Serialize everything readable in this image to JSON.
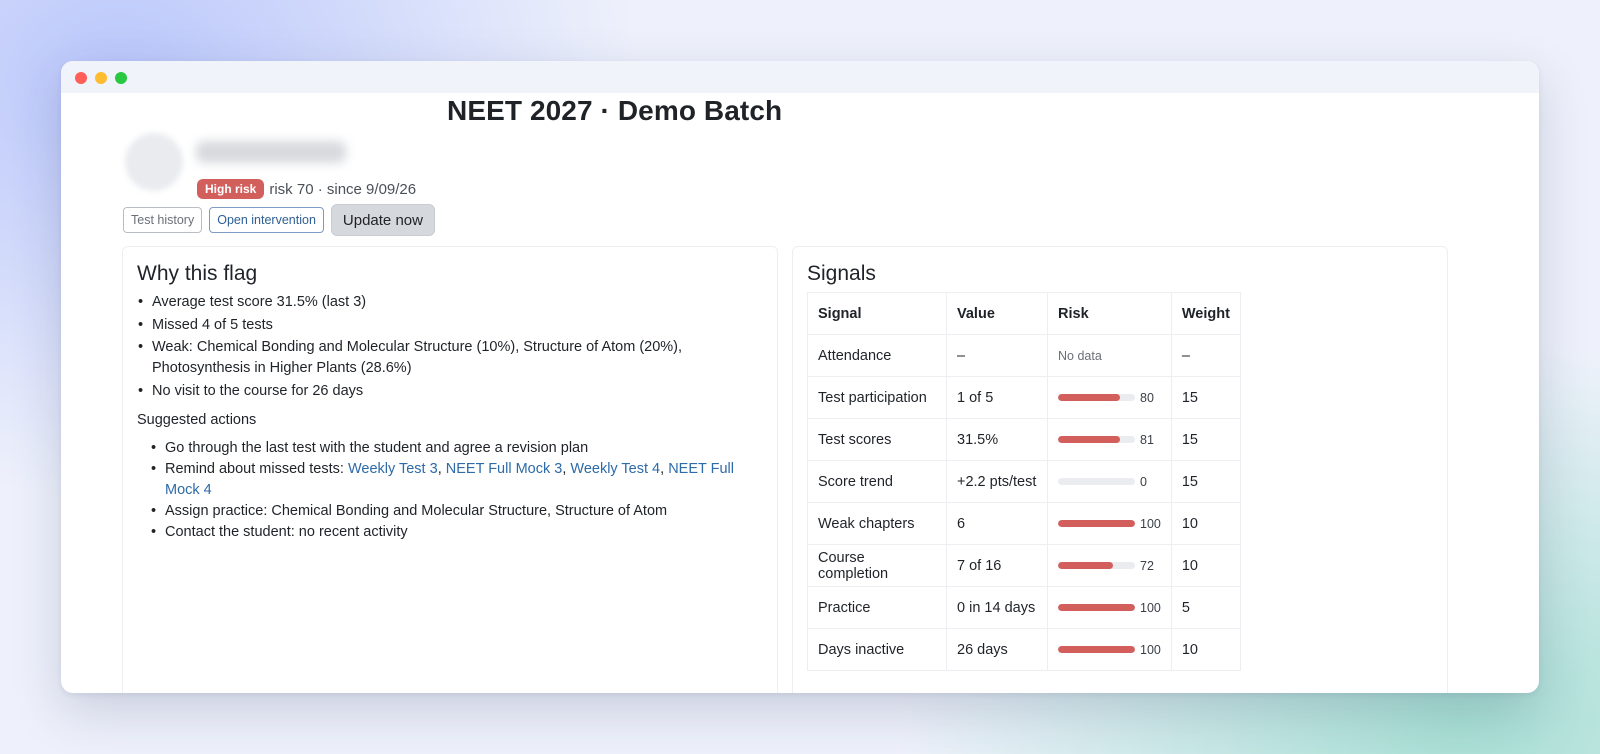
{
  "window": {
    "traffic_lights": [
      "close",
      "minimize",
      "zoom"
    ]
  },
  "header": {
    "title": "NEET 2027 · Demo Batch",
    "student_name": "",
    "risk_badge": "High risk",
    "risk_meta": "risk 70 · since 9/09/26"
  },
  "actions": {
    "test_history": "Test history",
    "open_intervention": "Open intervention",
    "update_now": "Update now"
  },
  "why_flag": {
    "title": "Why this flag",
    "reasons": [
      "Average test score 31.5% (last 3)",
      "Missed 4 of 5 tests",
      "Weak: Chemical Bonding and Molecular Structure (10%), Structure of Atom (20%), Photosynthesis in Higher Plants (28.6%)",
      "No visit to the course for 26 days"
    ],
    "suggested_title": "Suggested actions",
    "suggested": {
      "s1": "Go through the last test with the student and agree a revision plan",
      "s2_prefix": "Remind about missed tests: ",
      "s2_links": [
        "Weekly Test 3",
        "NEET Full Mock 3",
        "Weekly Test 4",
        "NEET Full Mock 4"
      ],
      "s2_sep": ", ",
      "s3": "Assign practice: Chemical Bonding and Molecular Structure, Structure of Atom",
      "s4": "Contact the student: no recent activity"
    }
  },
  "signals": {
    "title": "Signals",
    "columns": [
      "Signal",
      "Value",
      "Risk",
      "Weight"
    ],
    "rows": [
      {
        "signal": "Attendance",
        "value": "–",
        "risk_text": "No data",
        "risk": null,
        "weight": "–"
      },
      {
        "signal": "Test participation",
        "value": "1 of 5",
        "risk_text": "80",
        "risk": 80,
        "weight": "15"
      },
      {
        "signal": "Test scores",
        "value": "31.5%",
        "risk_text": "81",
        "risk": 81,
        "weight": "15"
      },
      {
        "signal": "Score trend",
        "value": "+2.2 pts/test",
        "risk_text": "0",
        "risk": 0,
        "weight": "15"
      },
      {
        "signal": "Weak chapters",
        "value": "6",
        "risk_text": "100",
        "risk": 100,
        "weight": "10"
      },
      {
        "signal": "Course completion",
        "value": "7 of 16",
        "risk_text": "72",
        "risk": 72,
        "weight": "10"
      },
      {
        "signal": "Practice",
        "value": "0 in 14 days",
        "risk_text": "100",
        "risk": 100,
        "weight": "5"
      },
      {
        "signal": "Days inactive",
        "value": "26 days",
        "risk_text": "100",
        "risk": 100,
        "weight": "10"
      }
    ]
  },
  "colors": {
    "risk_high": "#d25f5c",
    "link": "#2d6aa8",
    "bar_track": "#eaecef"
  }
}
